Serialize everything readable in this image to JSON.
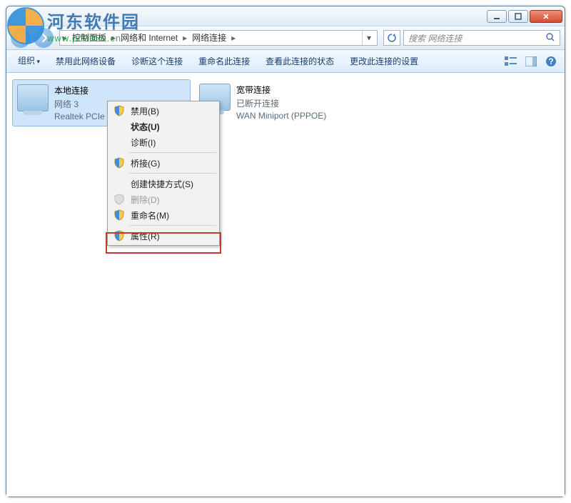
{
  "watermark": {
    "title": "河东软件园",
    "url": "www.pc0359.cn"
  },
  "breadcrumb": {
    "p1": "控制面板",
    "p2": "网络和 Internet",
    "p3": "网络连接"
  },
  "search": {
    "placeholder": "搜索 网络连接"
  },
  "toolbar": {
    "organize": "组织",
    "disable": "禁用此网络设备",
    "diagnose": "诊断这个连接",
    "rename": "重命名此连接",
    "status": "查看此连接的状态",
    "change": "更改此连接的设置"
  },
  "connections": [
    {
      "name": "本地连接",
      "sub1": "网络  3",
      "sub2": "Realtek PCIe"
    },
    {
      "name": "宽带连接",
      "sub1": "已断开连接",
      "sub2": "WAN Miniport (PPPOE)"
    }
  ],
  "ctx": {
    "disable": "禁用(B)",
    "status": "状态(U)",
    "diagnose": "诊断(I)",
    "bridge": "桥接(G)",
    "shortcut": "创建快捷方式(S)",
    "delete": "删除(D)",
    "rename": "重命名(M)",
    "properties": "属性(R)"
  }
}
